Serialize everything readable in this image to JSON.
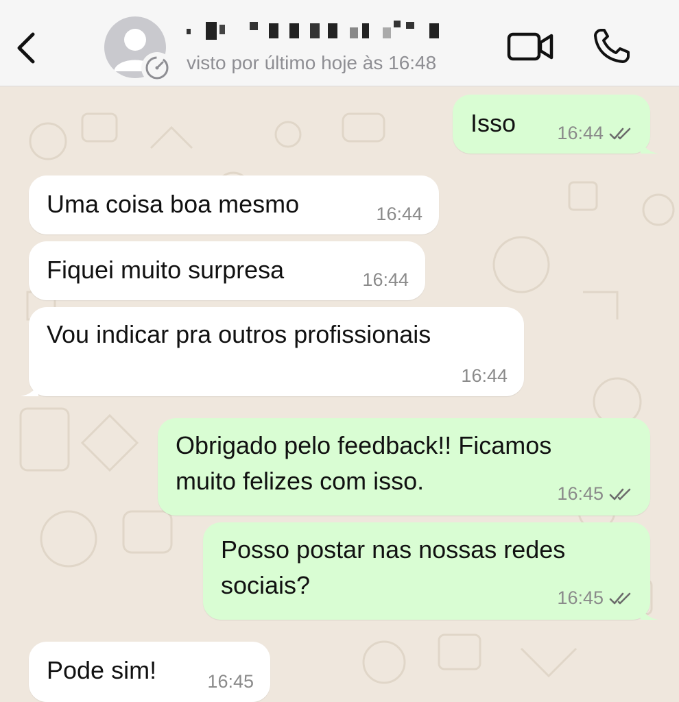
{
  "header": {
    "back_icon": "chevron-left-icon",
    "contact_name_redacted": true,
    "status": "visto por último hoje às 16:48",
    "video_icon": "video-camera-icon",
    "call_icon": "phone-icon"
  },
  "colors": {
    "incoming_bubble": "#ffffff",
    "outgoing_bubble": "#d9fdd3",
    "chat_background": "#efe7dd",
    "tick_color": "#6b6b6b"
  },
  "messages": [
    {
      "direction": "out",
      "text": "Isso",
      "time": "16:44",
      "status": "delivered-double-tick"
    },
    {
      "direction": "in",
      "text": "Uma coisa boa mesmo",
      "time": "16:44"
    },
    {
      "direction": "in",
      "text": "Fiquei muito surpresa",
      "time": "16:44"
    },
    {
      "direction": "in",
      "text": "Vou indicar pra outros profissionais",
      "time": "16:44"
    },
    {
      "direction": "out",
      "text": "Obrigado pelo feedback!! Ficamos\nmuito felizes com isso.",
      "time": "16:45",
      "status": "delivered-double-tick"
    },
    {
      "direction": "out",
      "text": "Posso postar nas nossas redes\nsociais?",
      "time": "16:45",
      "status": "delivered-double-tick"
    },
    {
      "direction": "in",
      "text": "Pode sim!",
      "time": "16:45"
    }
  ]
}
